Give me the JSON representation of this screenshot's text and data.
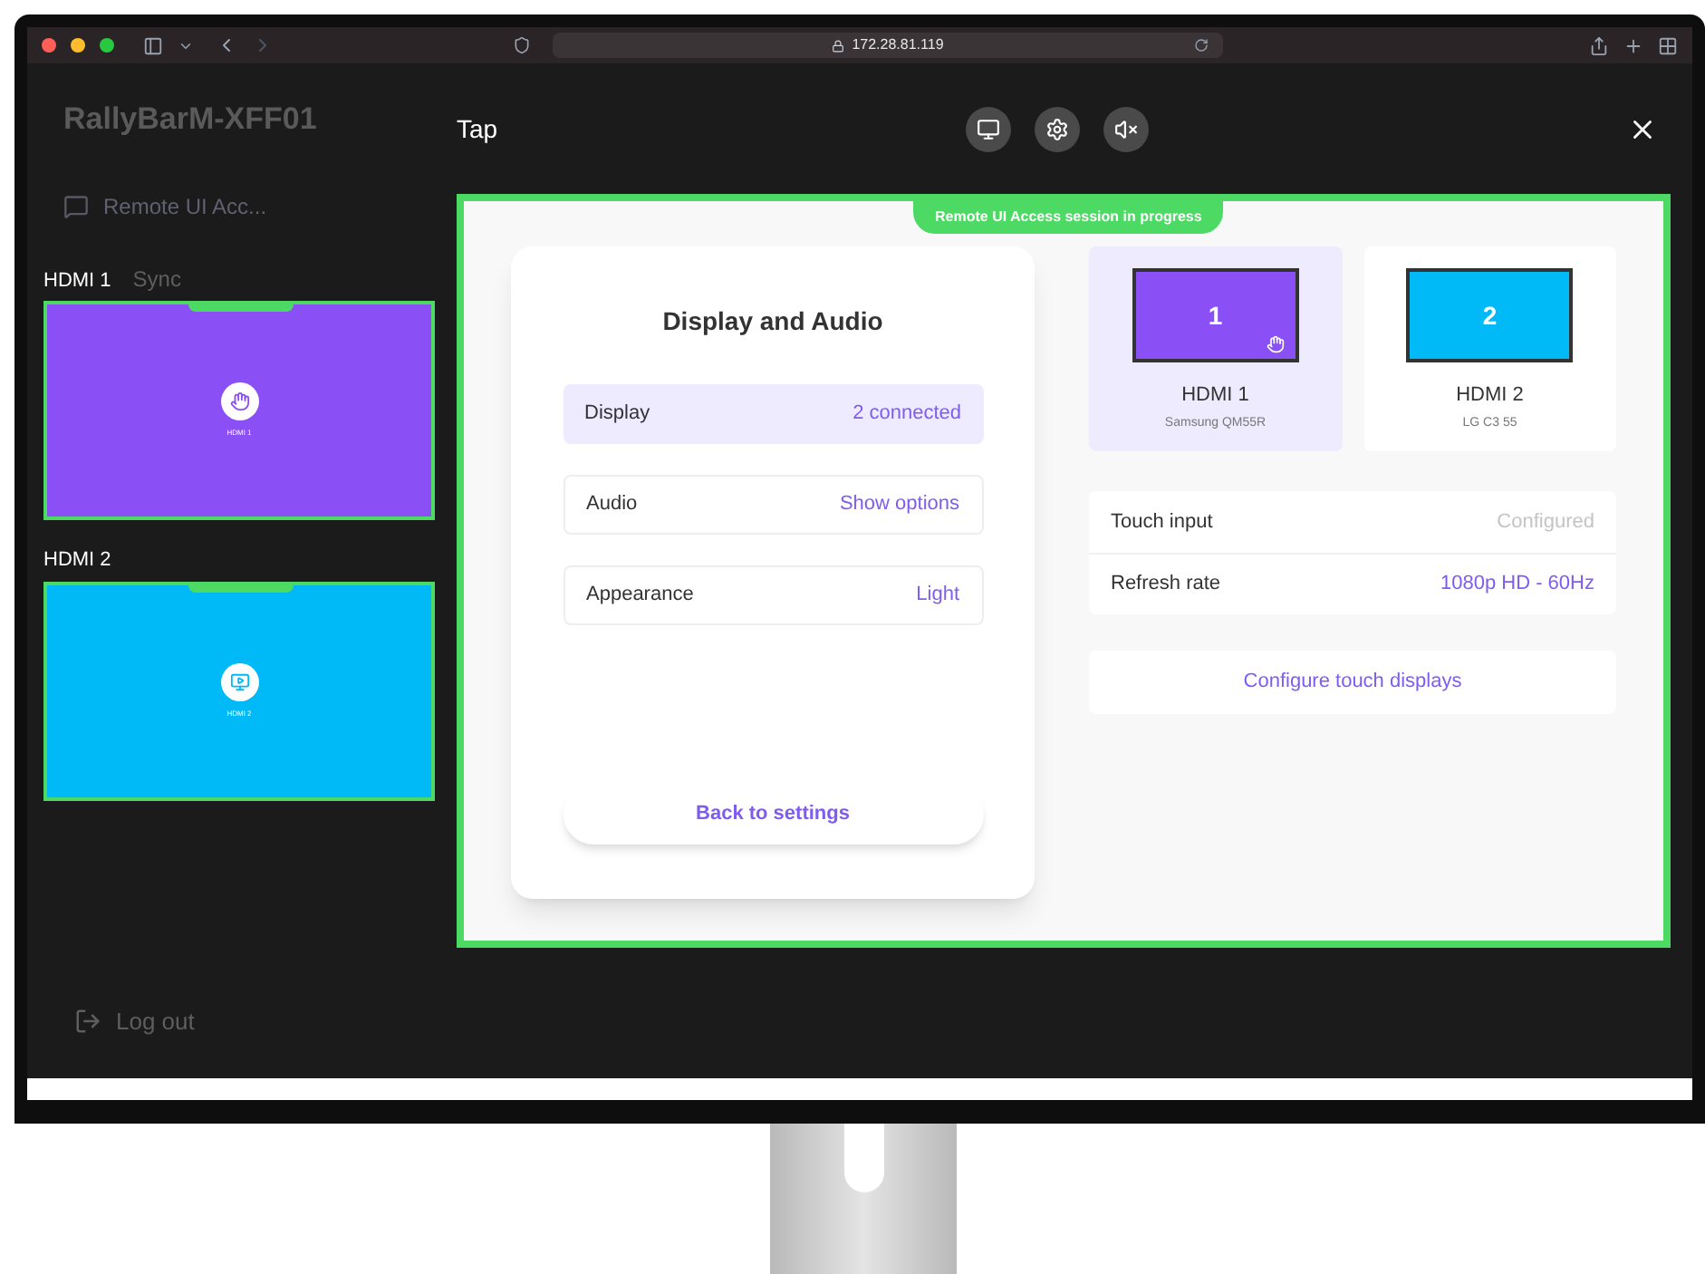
{
  "browser": {
    "url": "172.28.81.119"
  },
  "background_page": {
    "device_name": "RallyBarM-XFF01",
    "nav_item": "Remote UI Acc...",
    "sync_label": "Sync",
    "logout": "Log out"
  },
  "previews": [
    {
      "label": "HDMI 1",
      "caption": "HDMI 1",
      "color": "#8a4ff5",
      "kind": "touch"
    },
    {
      "label": "HDMI 2",
      "caption": "HDMI 2",
      "color": "#00b9f7",
      "kind": "screen"
    }
  ],
  "modal": {
    "title": "Tap",
    "session_banner": "Remote UI Access session in progress"
  },
  "card": {
    "title": "Display and Audio",
    "rows": [
      {
        "label": "Display",
        "value": "2 connected",
        "selected": true
      },
      {
        "label": "Audio",
        "value": "Show options",
        "selected": false
      },
      {
        "label": "Appearance",
        "value": "Light",
        "selected": false
      }
    ],
    "back_button": "Back to settings"
  },
  "displays": [
    {
      "number": "1",
      "name": "HDMI 1",
      "model": "Samsung QM55R",
      "color": "#8a4ff5",
      "selected": true,
      "touch": true
    },
    {
      "number": "2",
      "name": "HDMI 2",
      "model": "LG C3 55",
      "color": "#00b9f7",
      "selected": false,
      "touch": false
    }
  ],
  "settings_rows": [
    {
      "label": "Touch input",
      "value": "Configured",
      "disabled": true
    },
    {
      "label": "Refresh rate",
      "value": "1080p HD - 60Hz",
      "disabled": false
    }
  ],
  "configure_button": "Configure touch displays"
}
